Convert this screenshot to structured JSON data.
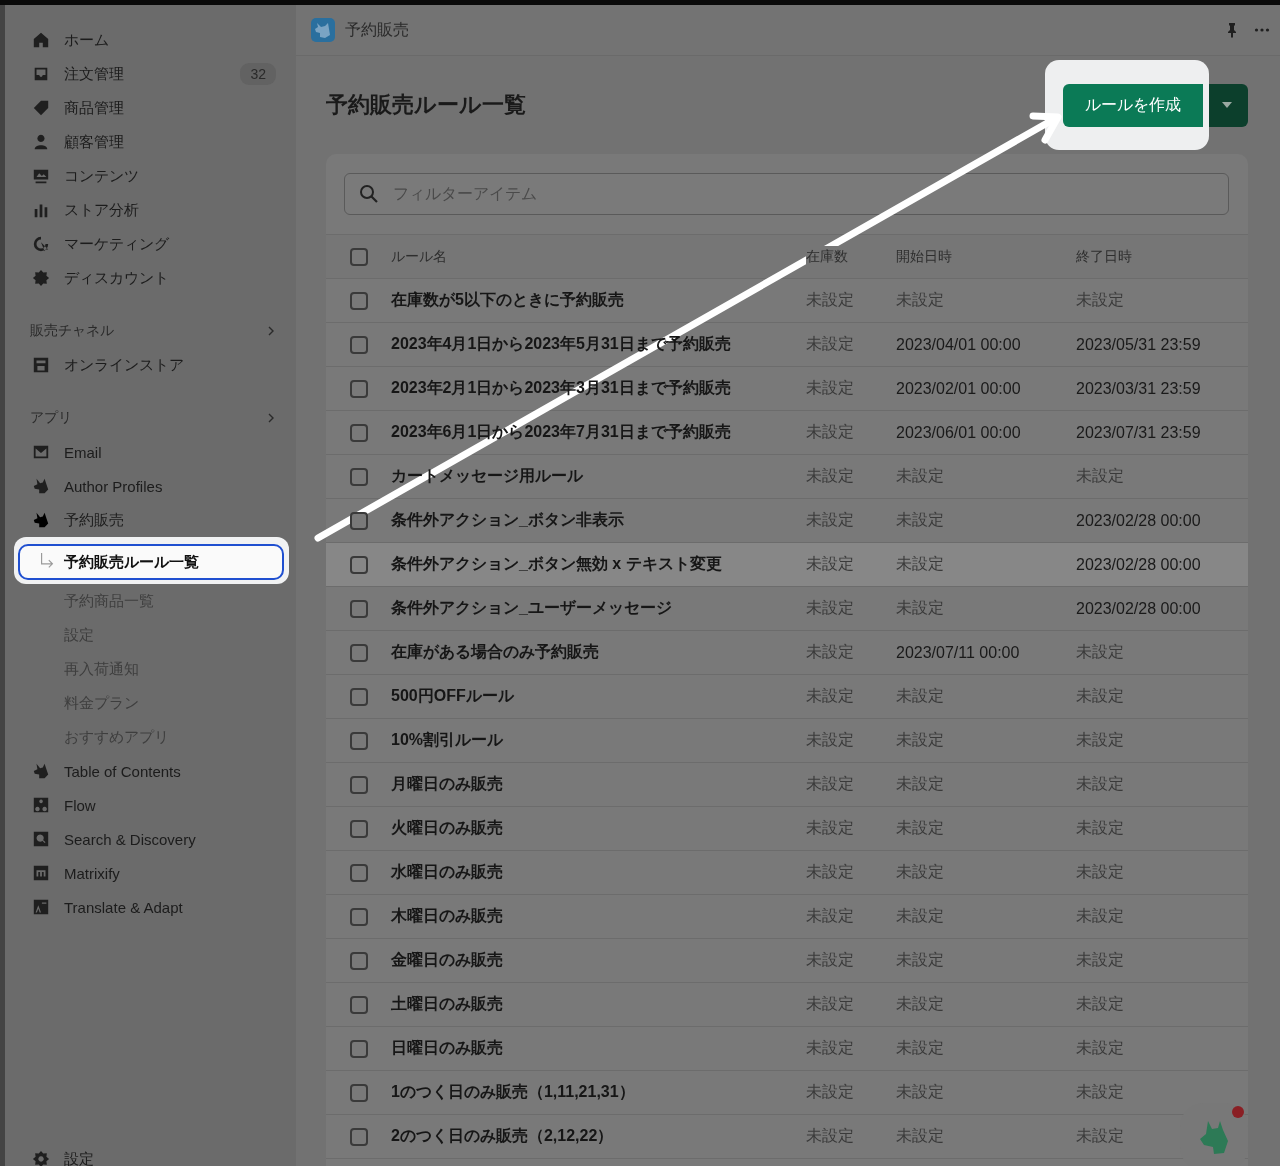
{
  "sidebar": {
    "nav": [
      {
        "label": "ホーム"
      },
      {
        "label": "注文管理",
        "badge": "32"
      },
      {
        "label": "商品管理"
      },
      {
        "label": "顧客管理"
      },
      {
        "label": "コンテンツ"
      },
      {
        "label": "ストア分析"
      },
      {
        "label": "マーケティング"
      },
      {
        "label": "ディスカウント"
      }
    ],
    "channels": {
      "title": "販売チャネル",
      "items": [
        {
          "label": "オンラインストア"
        }
      ]
    },
    "apps": {
      "title": "アプリ",
      "items": [
        {
          "label": "Email"
        },
        {
          "label": "Author Profiles"
        },
        {
          "label": "予約販売",
          "children": [
            {
              "label": "予約販売ルール一覧",
              "selected": true
            },
            {
              "label": "予約商品一覧",
              "selected": false
            },
            {
              "label": "設定",
              "selected": false
            },
            {
              "label": "再入荷通知",
              "selected": false
            },
            {
              "label": "料金プラン",
              "selected": false
            },
            {
              "label": "おすすめアプリ",
              "selected": false
            }
          ]
        },
        {
          "label": "Table of Contents"
        },
        {
          "label": "Flow"
        },
        {
          "label": "Search & Discovery"
        },
        {
          "label": "Matrixify"
        },
        {
          "label": "Translate & Adapt"
        }
      ]
    },
    "footer": {
      "label": "設定"
    }
  },
  "app_bar": {
    "title": "予約販売"
  },
  "page": {
    "title": "予約販売ルール一覧",
    "primary_button": "ルールを作成"
  },
  "search": {
    "placeholder": "フィルターアイテム"
  },
  "table": {
    "columns": [
      "ルール名",
      "在庫数",
      "開始日時",
      "終了日時"
    ],
    "header_checked": false,
    "rows": [
      {
        "checked": false,
        "highlighted": false,
        "cells": [
          {
            "text": "在庫数が5以下のときに予約販売",
            "muted": false
          },
          {
            "text": "未設定",
            "muted": true
          },
          {
            "text": "未設定",
            "muted": true
          },
          {
            "text": "未設定",
            "muted": true
          }
        ]
      },
      {
        "checked": false,
        "highlighted": false,
        "cells": [
          {
            "text": "2023年4月1日から2023年5月31日まで予約販売",
            "muted": false
          },
          {
            "text": "未設定",
            "muted": true
          },
          {
            "text": "2023/04/01 00:00",
            "muted": false
          },
          {
            "text": "2023/05/31 23:59",
            "muted": false
          }
        ]
      },
      {
        "checked": false,
        "highlighted": false,
        "cells": [
          {
            "text": "2023年2月1日から2023年3月31日まで予約販売",
            "muted": false
          },
          {
            "text": "未設定",
            "muted": true
          },
          {
            "text": "2023/02/01 00:00",
            "muted": false
          },
          {
            "text": "2023/03/31 23:59",
            "muted": false
          }
        ]
      },
      {
        "checked": false,
        "highlighted": false,
        "cells": [
          {
            "text": "2023年6月1日から2023年7月31日まで予約販売",
            "muted": false
          },
          {
            "text": "未設定",
            "muted": true
          },
          {
            "text": "2023/06/01 00:00",
            "muted": false
          },
          {
            "text": "2023/07/31 23:59",
            "muted": false
          }
        ]
      },
      {
        "checked": false,
        "highlighted": false,
        "cells": [
          {
            "text": "カートメッセージ用ルール",
            "muted": false
          },
          {
            "text": "未設定",
            "muted": true
          },
          {
            "text": "未設定",
            "muted": true
          },
          {
            "text": "未設定",
            "muted": true
          }
        ]
      },
      {
        "checked": false,
        "highlighted": false,
        "cells": [
          {
            "text": "条件外アクション_ボタン非表示",
            "muted": false
          },
          {
            "text": "未設定",
            "muted": true
          },
          {
            "text": "未設定",
            "muted": true
          },
          {
            "text": "2023/02/28 00:00",
            "muted": false
          }
        ]
      },
      {
        "checked": false,
        "highlighted": true,
        "cells": [
          {
            "text": "条件外アクション_ボタン無効 x テキスト変更",
            "muted": false
          },
          {
            "text": "未設定",
            "muted": true
          },
          {
            "text": "未設定",
            "muted": true
          },
          {
            "text": "2023/02/28 00:00",
            "muted": false
          }
        ]
      },
      {
        "checked": false,
        "highlighted": false,
        "cells": [
          {
            "text": "条件外アクション_ユーザーメッセージ",
            "muted": false
          },
          {
            "text": "未設定",
            "muted": true
          },
          {
            "text": "未設定",
            "muted": true
          },
          {
            "text": "2023/02/28 00:00",
            "muted": false
          }
        ]
      },
      {
        "checked": false,
        "highlighted": false,
        "cells": [
          {
            "text": "在庫がある場合のみ予約販売",
            "muted": false
          },
          {
            "text": "未設定",
            "muted": true
          },
          {
            "text": "2023/07/11 00:00",
            "muted": false
          },
          {
            "text": "未設定",
            "muted": true
          }
        ]
      },
      {
        "checked": false,
        "highlighted": false,
        "cells": [
          {
            "text": "500円OFFルール",
            "muted": false
          },
          {
            "text": "未設定",
            "muted": true
          },
          {
            "text": "未設定",
            "muted": true
          },
          {
            "text": "未設定",
            "muted": true
          }
        ]
      },
      {
        "checked": false,
        "highlighted": false,
        "cells": [
          {
            "text": "10%割引ルール",
            "muted": false
          },
          {
            "text": "未設定",
            "muted": true
          },
          {
            "text": "未設定",
            "muted": true
          },
          {
            "text": "未設定",
            "muted": true
          }
        ]
      },
      {
        "checked": false,
        "highlighted": false,
        "cells": [
          {
            "text": "月曜日のみ販売",
            "muted": false
          },
          {
            "text": "未設定",
            "muted": true
          },
          {
            "text": "未設定",
            "muted": true
          },
          {
            "text": "未設定",
            "muted": true
          }
        ]
      },
      {
        "checked": false,
        "highlighted": false,
        "cells": [
          {
            "text": "火曜日のみ販売",
            "muted": false
          },
          {
            "text": "未設定",
            "muted": true
          },
          {
            "text": "未設定",
            "muted": true
          },
          {
            "text": "未設定",
            "muted": true
          }
        ]
      },
      {
        "checked": false,
        "highlighted": false,
        "cells": [
          {
            "text": "水曜日のみ販売",
            "muted": false
          },
          {
            "text": "未設定",
            "muted": true
          },
          {
            "text": "未設定",
            "muted": true
          },
          {
            "text": "未設定",
            "muted": true
          }
        ]
      },
      {
        "checked": false,
        "highlighted": false,
        "cells": [
          {
            "text": "木曜日のみ販売",
            "muted": false
          },
          {
            "text": "未設定",
            "muted": true
          },
          {
            "text": "未設定",
            "muted": true
          },
          {
            "text": "未設定",
            "muted": true
          }
        ]
      },
      {
        "checked": false,
        "highlighted": false,
        "cells": [
          {
            "text": "金曜日のみ販売",
            "muted": false
          },
          {
            "text": "未設定",
            "muted": true
          },
          {
            "text": "未設定",
            "muted": true
          },
          {
            "text": "未設定",
            "muted": true
          }
        ]
      },
      {
        "checked": false,
        "highlighted": false,
        "cells": [
          {
            "text": "土曜日のみ販売",
            "muted": false
          },
          {
            "text": "未設定",
            "muted": true
          },
          {
            "text": "未設定",
            "muted": true
          },
          {
            "text": "未設定",
            "muted": true
          }
        ]
      },
      {
        "checked": false,
        "highlighted": false,
        "cells": [
          {
            "text": "日曜日のみ販売",
            "muted": false
          },
          {
            "text": "未設定",
            "muted": true
          },
          {
            "text": "未設定",
            "muted": true
          },
          {
            "text": "未設定",
            "muted": true
          }
        ]
      },
      {
        "checked": false,
        "highlighted": false,
        "cells": [
          {
            "text": "1のつく日のみ販売（1,11,21,31）",
            "muted": false
          },
          {
            "text": "未設定",
            "muted": true
          },
          {
            "text": "未設定",
            "muted": true
          },
          {
            "text": "未設定",
            "muted": true
          }
        ]
      },
      {
        "checked": false,
        "highlighted": false,
        "cells": [
          {
            "text": "2のつく日のみ販売（2,12,22）",
            "muted": false
          },
          {
            "text": "未設定",
            "muted": true
          },
          {
            "text": "未設定",
            "muted": true
          },
          {
            "text": "未設定",
            "muted": true
          }
        ]
      }
    ]
  }
}
